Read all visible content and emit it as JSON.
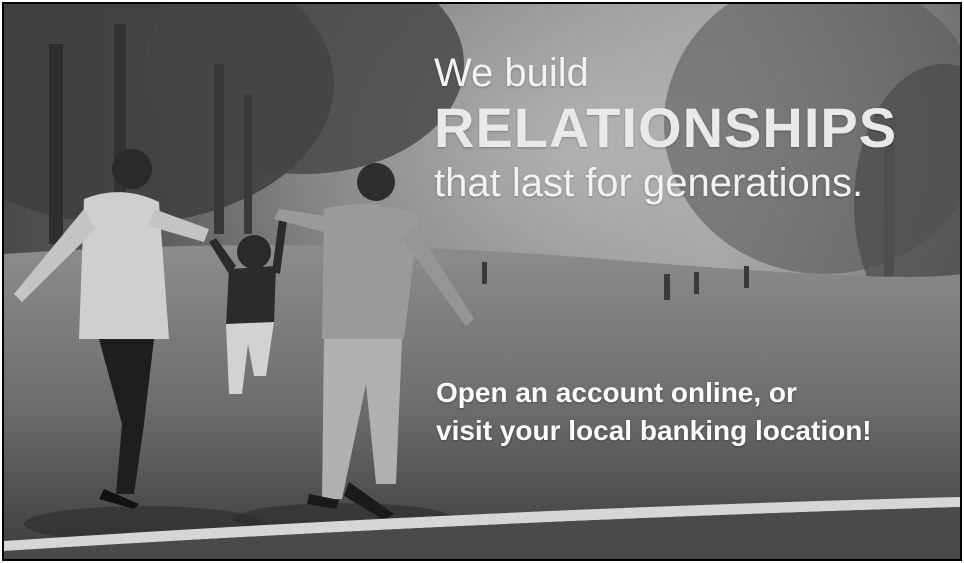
{
  "headline": {
    "line1": "We build",
    "line2": "RELATIONSHIPS",
    "line3": "that last for generations."
  },
  "cta": {
    "line1": "Open an account online, or",
    "line2": "visit your local banking location!"
  },
  "colors": {
    "text_light": "#f2f2f2",
    "band_light": "#cfcfcf",
    "band_dark": "#5a5a5a"
  },
  "photo": {
    "description_icon": "family-walking-photo"
  }
}
